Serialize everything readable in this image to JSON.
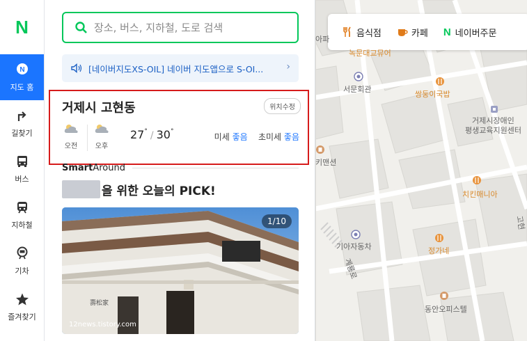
{
  "nav": {
    "logo": "N",
    "items": [
      {
        "label": "지도 홈",
        "icon": "map-pin-icon",
        "active": true
      },
      {
        "label": "길찾기",
        "icon": "directions-icon",
        "active": false
      },
      {
        "label": "버스",
        "icon": "bus-icon",
        "active": false
      },
      {
        "label": "지하철",
        "icon": "subway-icon",
        "active": false
      },
      {
        "label": "기차",
        "icon": "train-icon",
        "active": false
      },
      {
        "label": "즐겨찾기",
        "icon": "star-icon",
        "active": false
      }
    ]
  },
  "search": {
    "placeholder": "장소, 버스, 지하철, 도로 검색"
  },
  "notice": {
    "text": "[네이버지도XS-OIL] 네이버 지도앱으로 S-OI..."
  },
  "weather": {
    "location": "거제시 고현동",
    "edit_label": "위치수정",
    "am_label": "오전",
    "pm_label": "오후",
    "low": "27",
    "high": "30",
    "degree": "°",
    "fine_dust_label": "미세",
    "fine_dust_value": "좋음",
    "ultrafine_dust_label": "초미세",
    "ultrafine_dust_value": "좋음"
  },
  "smart_around": {
    "brand_a": "Smart",
    "brand_b": "Around"
  },
  "pick": {
    "title": "을 위한 오늘의 PICK!"
  },
  "photo": {
    "counter": "1/10",
    "watermark": "12news.tistory.com"
  },
  "map": {
    "categories": [
      {
        "label": "음식점",
        "icon": "fork-knife-icon"
      },
      {
        "label": "카페",
        "icon": "coffee-cup-icon"
      },
      {
        "label": "네이버주문",
        "icon": "naver-n-icon"
      }
    ],
    "pois": {
      "top_partial": "아파",
      "top_partial2": "녹문대교뮤어",
      "seomun": "서문회관",
      "ssangdung": "쌍둥이국밥",
      "geoje_center_1": "거제시장애인",
      "geoje_center_2": "평생교육지원센터",
      "kimaension": "키맨션",
      "chicken": "치킨매니아",
      "kia": "기아자동차",
      "gyeryong": "계룡로",
      "jeongga": "정가네",
      "go": "고현",
      "dongan": "동안오피스텔"
    }
  }
}
